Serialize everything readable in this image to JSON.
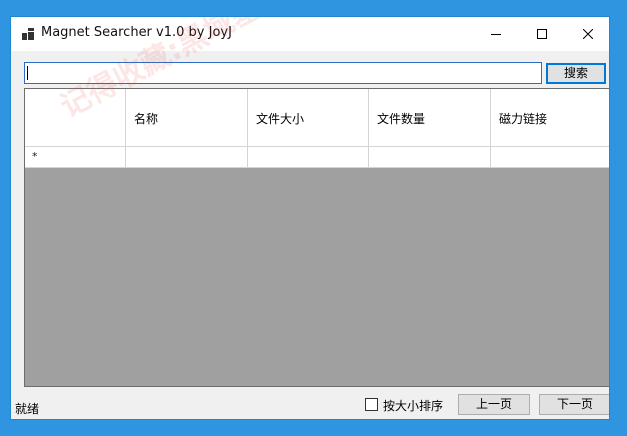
{
  "window": {
    "title": "Magnet Searcher v1.0 by JoyJ"
  },
  "search": {
    "value": "",
    "button_label": "搜索"
  },
  "grid": {
    "columns": [
      "名称",
      "文件大小",
      "文件数量",
      "磁力链接"
    ],
    "new_row_marker": "*"
  },
  "status": {
    "text": "就绪"
  },
  "footer": {
    "sort_label": "按大小排序",
    "sort_checked": false,
    "prev_label": "上一页",
    "next_label": "下一页"
  },
  "watermark": {
    "text": "记得收藏:黑域基地 Hybase.com"
  },
  "colors": {
    "desktop": "#2f95e0",
    "accent": "#0078d7",
    "grid_background": "#a0a0a0"
  },
  "icons": [
    "app-icon",
    "minimize-icon",
    "maximize-icon",
    "close-icon"
  ]
}
